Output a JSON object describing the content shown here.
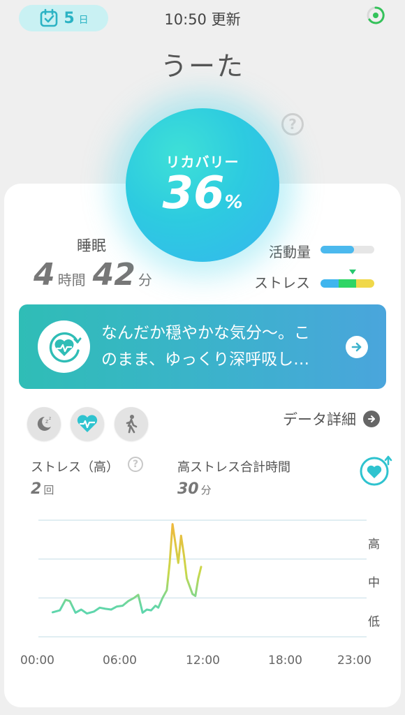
{
  "header": {
    "streak_days": "5",
    "streak_unit": "日",
    "update_time": "10:50 更新",
    "username": "うーた"
  },
  "recovery": {
    "label": "リカバリー",
    "value": "36",
    "unit": "%"
  },
  "sleep": {
    "label": "睡眠",
    "hours": "4",
    "hours_unit": "時間",
    "minutes": "42",
    "minutes_unit": "分"
  },
  "metrics": {
    "activity_label": "活動量",
    "activity_level": 0.62,
    "stress_label": "ストレス",
    "stress_segments": [
      "#3fb5ee",
      "#2fd565",
      "#f0d84a"
    ],
    "stress_marker_color": "#27c96e"
  },
  "message": {
    "line1": "なんだか穏やかな気分〜。こ",
    "line2": "のまま、ゆっくり深呼吸し…"
  },
  "modes": [
    "sleep-icon",
    "heart-wave-icon",
    "walk-icon"
  ],
  "data_detail_label": "データ詳細",
  "stats": {
    "stress_high_label": "ストレス（高）",
    "stress_high_count": "2",
    "stress_high_unit": "回",
    "high_stress_total_label": "高ストレス合計時間",
    "high_stress_total_value": "30",
    "high_stress_total_unit": "分"
  },
  "chart_data": {
    "type": "line",
    "xlabel": "",
    "ylabel": "",
    "x_ticks": [
      "00:00",
      "06:00",
      "12:00",
      "18:00",
      "23:00"
    ],
    "y_levels": [
      "高",
      "中",
      "低"
    ],
    "xlim": [
      0,
      23
    ],
    "ylim": [
      0,
      3
    ],
    "grid": true,
    "series": [
      {
        "x": [
          1.0,
          1.5,
          1.9,
          2.2,
          2.6,
          3.0,
          3.4,
          3.9,
          4.3,
          4.7,
          5.1,
          5.5,
          5.9,
          6.3,
          6.7,
          7.0,
          7.3,
          7.6,
          7.9,
          8.2,
          8.4,
          8.7,
          9.0,
          9.2,
          9.4,
          9.6,
          9.8,
          10.0,
          10.2,
          10.4,
          10.6,
          10.8,
          11.0,
          11.2,
          11.4
        ],
        "y": [
          0.63,
          0.68,
          0.95,
          0.92,
          0.62,
          0.7,
          0.6,
          0.65,
          0.75,
          0.72,
          0.7,
          0.78,
          0.8,
          0.92,
          1.0,
          1.08,
          0.62,
          0.7,
          0.68,
          0.8,
          0.75,
          1.0,
          1.2,
          1.9,
          2.9,
          2.4,
          1.9,
          2.6,
          2.1,
          1.5,
          1.3,
          1.1,
          1.05,
          1.5,
          1.8
        ]
      }
    ]
  }
}
